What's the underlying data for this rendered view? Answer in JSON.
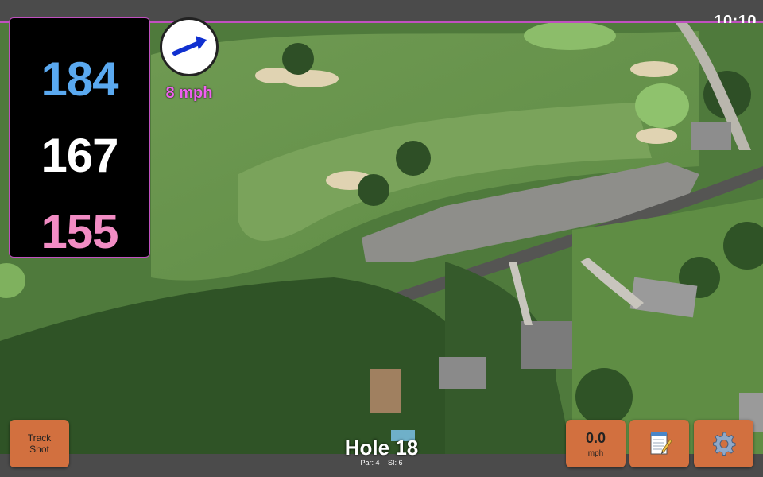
{
  "status": {
    "time": "10:10"
  },
  "distances": {
    "back": "184",
    "middle": "167",
    "front": "155"
  },
  "wind": {
    "label": "8 mph",
    "arrow_icon": "arrow-right-icon"
  },
  "buttons": {
    "track_shot_line1": "Track",
    "track_shot_line2": "Shot",
    "wind_speed_value": "0.0",
    "wind_speed_unit": "mph",
    "notes_icon": "notepad-icon",
    "settings_icon": "gear-icon"
  },
  "hole": {
    "title": "Hole 18",
    "par": "Par: 4",
    "si": "SI: 6"
  },
  "colors": {
    "accent": "#c050c0",
    "back_distance": "#5aa9f0",
    "front_distance": "#f28cc4",
    "button": "#d2703f"
  }
}
